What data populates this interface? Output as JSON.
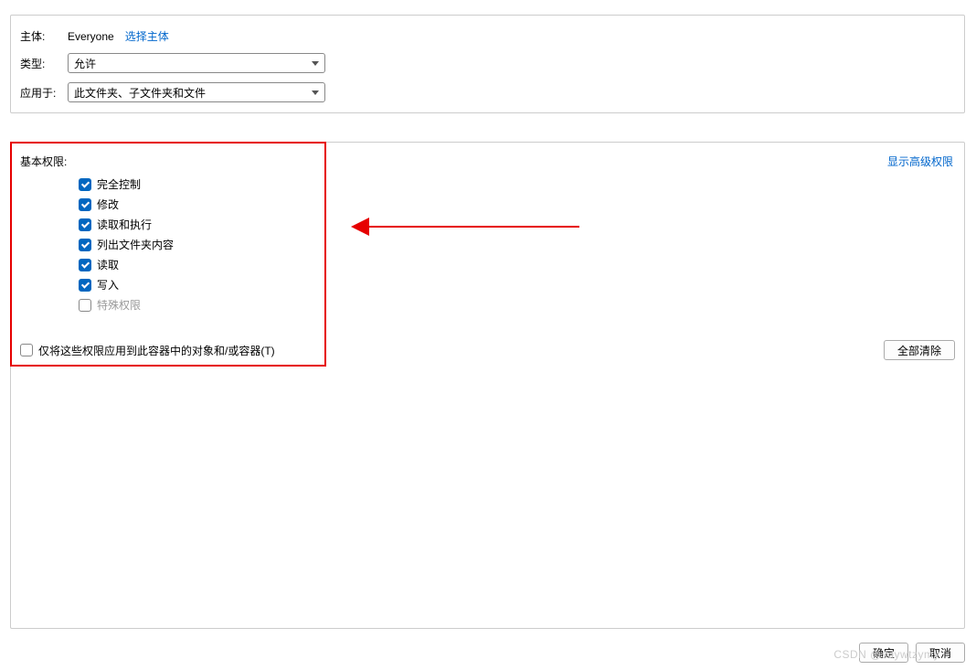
{
  "top": {
    "principal_label": "主体:",
    "principal_value": "Everyone",
    "select_principal_link": "选择主体",
    "type_label": "类型:",
    "type_value": "允许",
    "applies_label": "应用于:",
    "applies_value": "此文件夹、子文件夹和文件"
  },
  "perm": {
    "title": "基本权限:",
    "advanced_link": "显示高级权限",
    "items": [
      {
        "label": "完全控制",
        "checked": true,
        "disabled": false
      },
      {
        "label": "修改",
        "checked": true,
        "disabled": false
      },
      {
        "label": "读取和执行",
        "checked": true,
        "disabled": false
      },
      {
        "label": "列出文件夹内容",
        "checked": true,
        "disabled": false
      },
      {
        "label": "读取",
        "checked": true,
        "disabled": false
      },
      {
        "label": "写入",
        "checked": true,
        "disabled": false
      },
      {
        "label": "特殊权限",
        "checked": false,
        "disabled": true
      }
    ],
    "apply_only_label": "仅将这些权限应用到此容器中的对象和/或容器(T)",
    "clear_all": "全部清除"
  },
  "footer": {
    "ok": "确定",
    "cancel": "取消"
  },
  "watermark": "CSDN @sdywtzymy"
}
